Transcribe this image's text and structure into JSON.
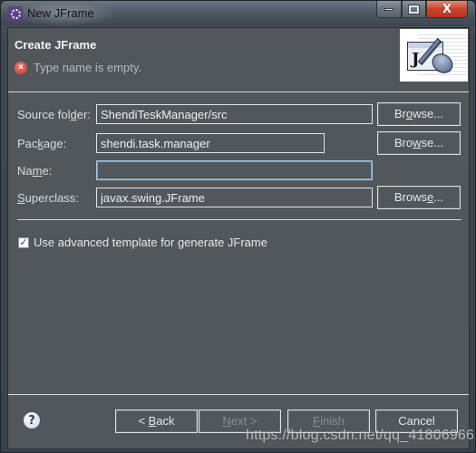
{
  "window": {
    "title": "New JFrame",
    "icon": "eclipse-gear-icon",
    "controls": {
      "minimize_icon": "minimize-icon",
      "maximize_icon": "maximize-icon",
      "close_glyph": "X"
    }
  },
  "header": {
    "title": "Create JFrame",
    "message": "Type name is empty.",
    "message_icon": "error-icon",
    "error_glyph": "×",
    "banner_icon": "jframe-wizard-banner",
    "banner_letter": "J"
  },
  "form": {
    "source_folder": {
      "label_pre": "Source fol",
      "label_mnemonic": "d",
      "label_post": "er:",
      "value": "ShendiTeskManager/src",
      "browse": {
        "pre": "Br",
        "mnemonic": "o",
        "post": "wse..."
      }
    },
    "package": {
      "label_pre": "Pac",
      "label_mnemonic": "k",
      "label_post": "age:",
      "value": "shendi.task.manager",
      "browse": {
        "pre": "Bro",
        "mnemonic": "w",
        "post": "se..."
      }
    },
    "name": {
      "label_pre": "Na",
      "label_mnemonic": "m",
      "label_post": "e:",
      "value": "",
      "placeholder": ""
    },
    "superclass": {
      "label_pre": "",
      "label_mnemonic": "S",
      "label_post": "uperclass:",
      "value": "javax.swing.JFrame",
      "browse": {
        "pre": "Brows",
        "mnemonic": "e",
        "post": "..."
      }
    },
    "advanced_template": {
      "checked": true,
      "check_glyph": "✓",
      "label": "Use advanced template for generate JFrame"
    }
  },
  "footer": {
    "help_glyph": "?",
    "back": {
      "pre": "< ",
      "mnemonic": "B",
      "post": "ack",
      "enabled": true
    },
    "next": {
      "pre": "",
      "mnemonic": "N",
      "post": "ext >",
      "enabled": false
    },
    "finish": {
      "pre": "",
      "mnemonic": "F",
      "post": "inish",
      "enabled": false
    },
    "cancel": {
      "label": "Cancel",
      "enabled": true
    }
  },
  "watermark": "https://blog.csdn.net/qq_41806966",
  "colors": {
    "dialog_bg": "#52575b",
    "text": "#e6e6e6",
    "disabled_text": "#8a8e92",
    "error": "#c8322a",
    "close_button": "#c8432c"
  }
}
